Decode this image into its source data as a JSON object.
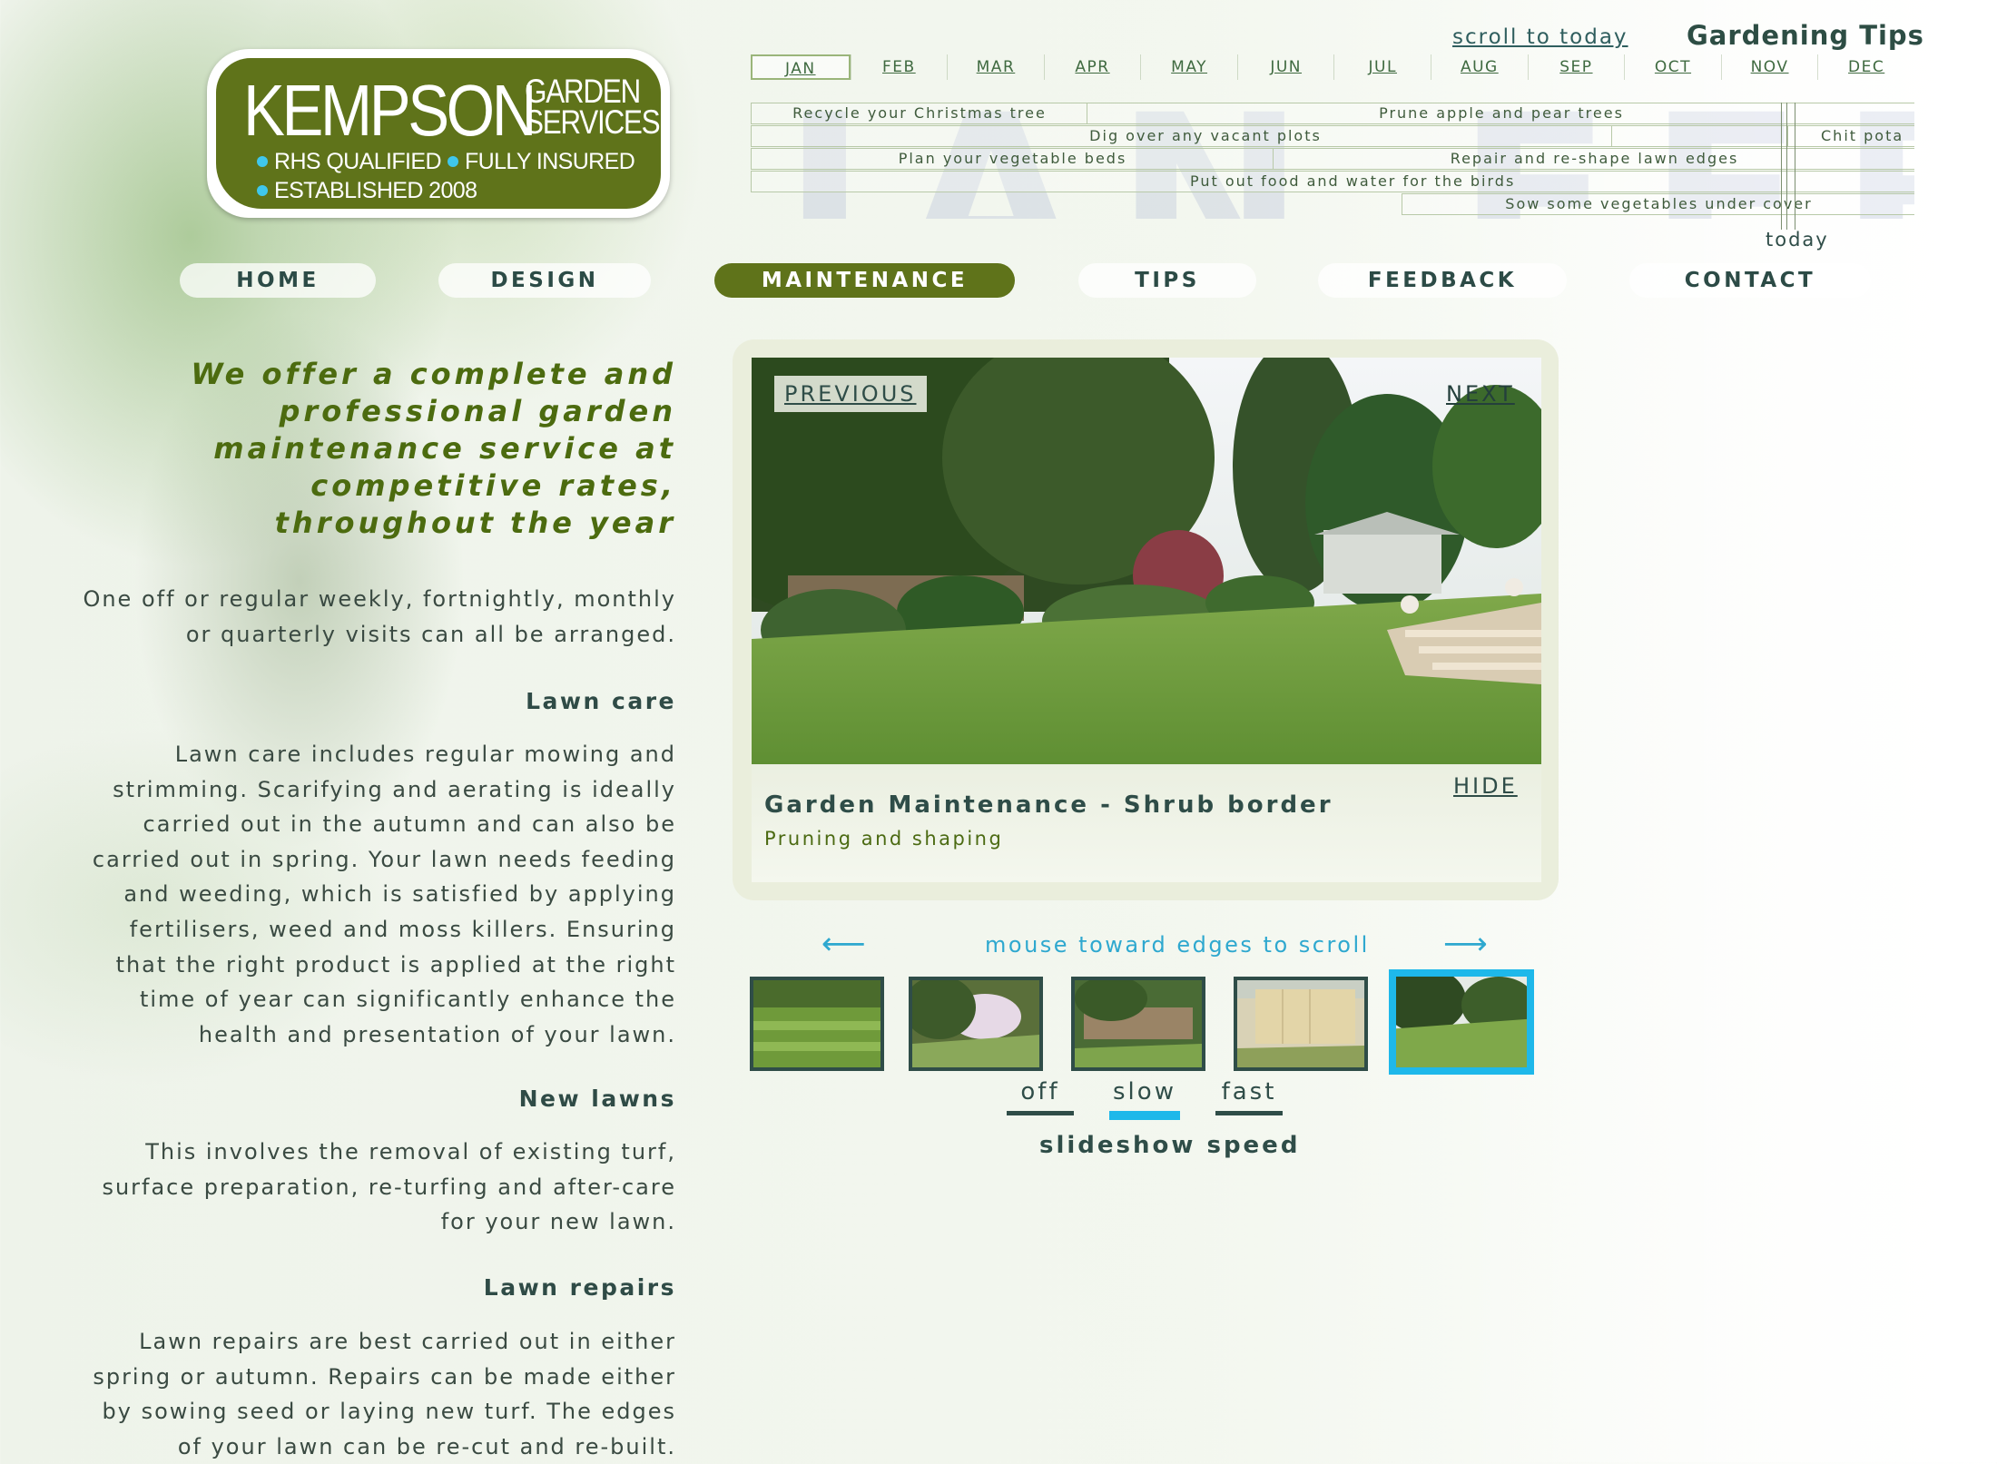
{
  "logo": {
    "name": "KEMPSON",
    "sub_line1": "GARDEN",
    "sub_line2": "SERVICES",
    "bullet1": "RHS QUALIFIED",
    "bullet2": "FULLY INSURED",
    "bullet3": "ESTABLISHED 2008",
    "color": "#5f731a"
  },
  "timeline": {
    "scroll_link": "scroll to today",
    "title": "Gardening Tips",
    "watermark": "JAN FEB",
    "months": [
      "JAN",
      "FEB",
      "MAR",
      "APR",
      "MAY",
      "JUN",
      "JUL",
      "AUG",
      "SEP",
      "OCT",
      "NOV",
      "DEC"
    ],
    "active_month": "JAN",
    "tips": [
      "Recycle your Christmas tree",
      "Prune apple and pear trees",
      "Dig over any vacant plots",
      "Chit pota",
      "Plan your vegetable beds",
      "Repair and re-shape lawn edges",
      "Put out food and water for the birds",
      "Sow some vegetables under cover"
    ],
    "today_label": "today"
  },
  "nav": {
    "items": [
      "HOME",
      "DESIGN",
      "MAINTENANCE",
      "TIPS",
      "FEEDBACK",
      "CONTACT"
    ],
    "active": "MAINTENANCE"
  },
  "content": {
    "lead": "We offer a complete and professional garden maintenance service at competitive rates, throughout the year",
    "intro": "One off or regular weekly, fortnightly, monthly or quarterly visits can all be arranged.",
    "sections": [
      {
        "heading": "Lawn care",
        "body": "Lawn care includes regular mowing and strimming. Scarifying and aerating is ideally carried out in the autumn and can also be carried out in spring. Your lawn needs feeding and weeding, which is satisfied by applying fertilisers, weed and moss killers. Ensuring that the right product is applied at the right time of year can significantly enhance the health and presentation of your lawn."
      },
      {
        "heading": "New lawns",
        "body": "This involves the removal of existing turf, surface preparation, re-turfing and after-care for your new lawn."
      },
      {
        "heading": "Lawn repairs",
        "body": "Lawn repairs are best carried out in either spring or autumn. Repairs can be made either by sowing seed or laying new turf. The edges of your lawn can be re-cut and re-built."
      }
    ]
  },
  "slideshow": {
    "previous_label": "PREVIOUS",
    "next_label": "NEXT",
    "hide_label": "HIDE",
    "caption_title": "Garden Maintenance - Shrub border",
    "caption_sub": "Pruning and shaping",
    "scroll_hint": "mouse toward edges to scroll",
    "arrow_left": "⟵",
    "arrow_right": "⟶",
    "selected_thumb": 5,
    "thumb_count": 5,
    "speed_options": [
      "off",
      "slow",
      "fast"
    ],
    "speed_selected": "slow",
    "speed_label": "slideshow speed",
    "accent_color": "#1eb8ea"
  }
}
